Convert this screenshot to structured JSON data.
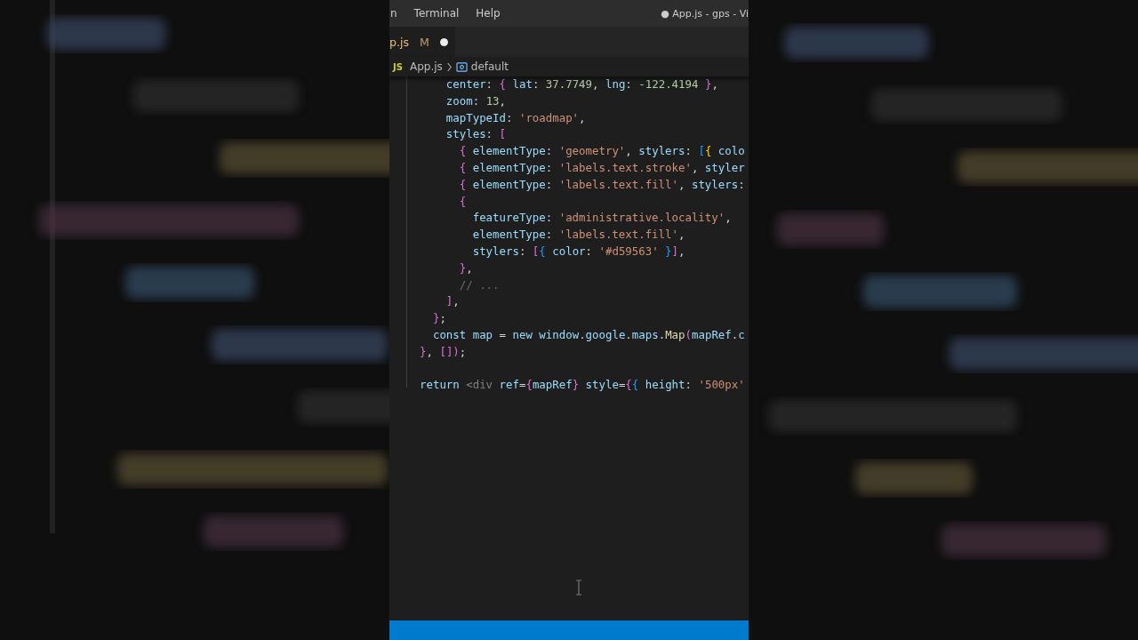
{
  "menu": [
    "n",
    "Terminal",
    "Help"
  ],
  "window": {
    "title": "● App.js - gps - Vi"
  },
  "tab": {
    "label": "p.js",
    "status": "M",
    "modified": true
  },
  "breadcrumb": {
    "lang": "JS",
    "file": "App.js",
    "symbol": "default"
  },
  "code": [
    [
      "    center: { lat: 37.7749, lng: -122.4194 },",
      "    zoom: 13,",
      "    mapTypeId: 'roadmap',",
      "    styles: [",
      "      { elementType: 'geometry', stylers: [{ colo",
      "      { elementType: 'labels.text.stroke', styler",
      "      { elementType: 'labels.text.fill', stylers:",
      "      {",
      "        featureType: 'administrative.locality',",
      "        elementType: 'labels.text.fill',",
      "        stylers: [{ color: '#d59563' }],",
      "      },",
      "      // ...",
      "    ],",
      "  };",
      "  const map = new window.google.maps.Map(mapRef.c",
      "}, []);"
    ],
    [
      "return <div ref={mapRef} style={{ height: '500px'"
    ]
  ]
}
